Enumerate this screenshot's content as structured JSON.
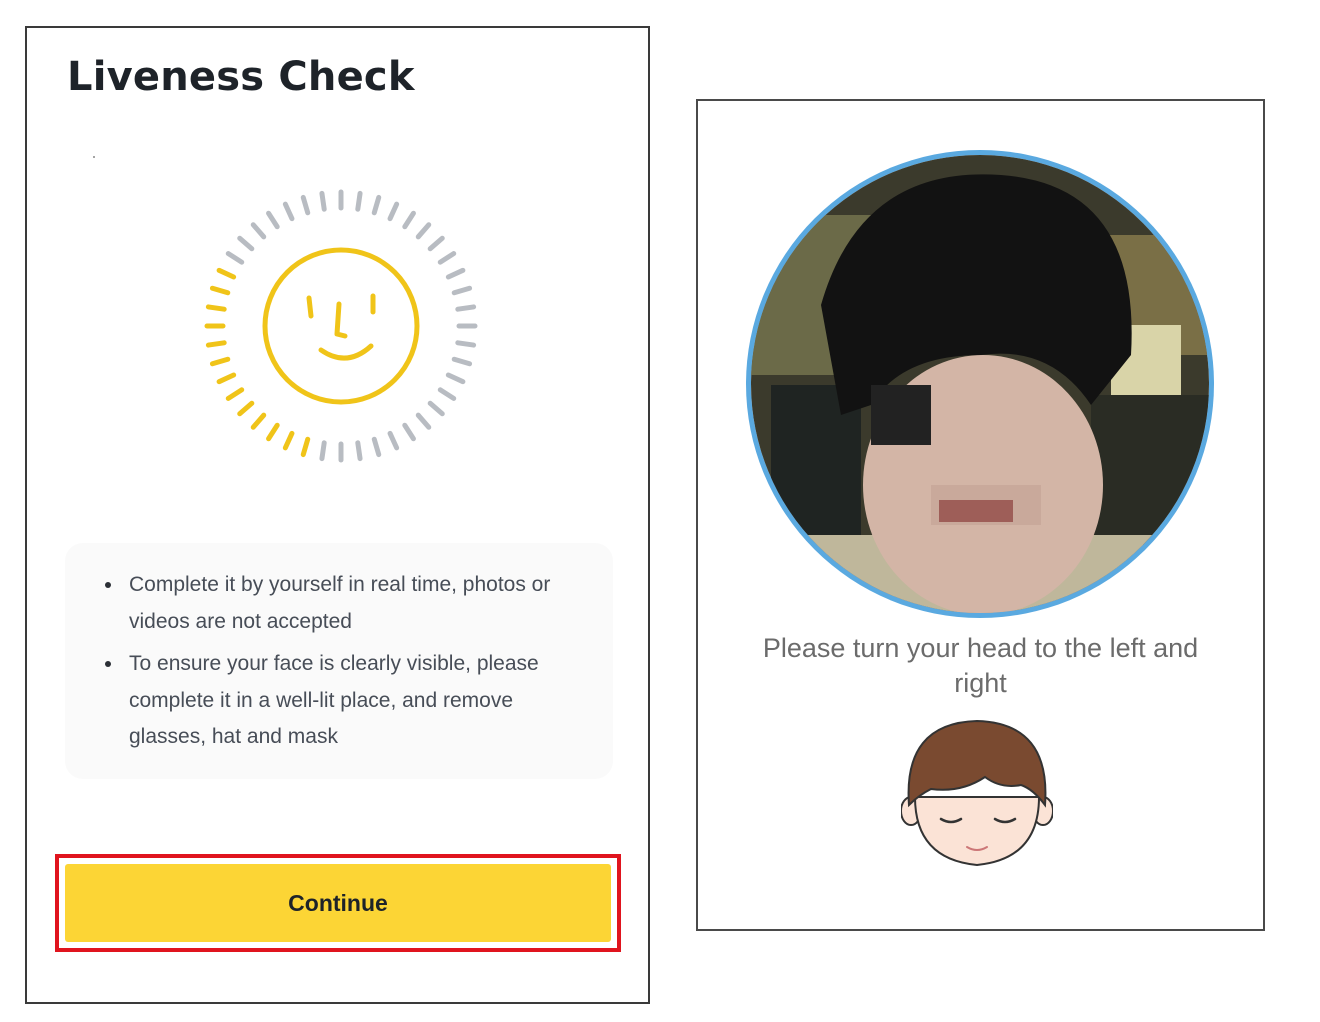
{
  "liveness": {
    "title": "Liveness Check",
    "tips": [
      "Complete it by yourself in real time, photos or videos are not accepted",
      "To ensure your face is clearly visible, please complete it in a well-lit place, and remove glasses, hat and mask"
    ],
    "continue_label": "Continue",
    "icons": {
      "face_scan": "face-scan-icon"
    },
    "colors": {
      "accent": "#fcd535",
      "highlight_border": "#e0141e",
      "scan_ring_active": "#f0c419",
      "scan_ring_idle": "#b8bcc2"
    }
  },
  "verification": {
    "instruction": "Please turn your head to the left and right",
    "icons": {
      "camera": "camera-preview",
      "avatar": "head-turn-avatar-icon"
    },
    "colors": {
      "camera_ring": "#5aa9e0"
    }
  }
}
